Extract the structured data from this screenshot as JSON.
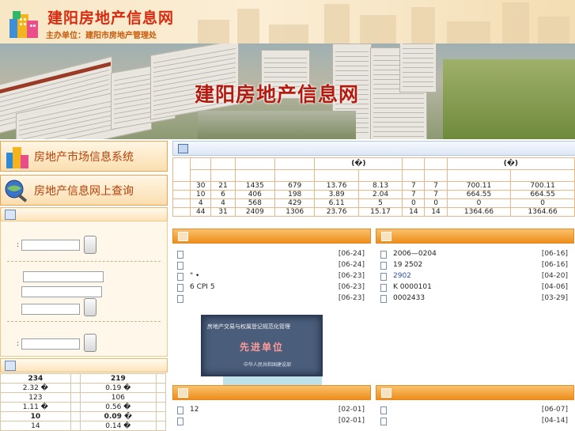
{
  "header": {
    "site_name": "建阳房地产信息网",
    "sponsor": "主办单位：建阳市房地产管理处"
  },
  "banner": {
    "title": "建阳房地产信息网"
  },
  "left": {
    "market_system_label": "房地产市场信息系统",
    "online_query_label": "房地产信息网上查询",
    "search_colon_1": ":",
    "search_colon_2": ":",
    "stats_rows": [
      {
        "a": "234",
        "b": "",
        "c": "219",
        "d": "",
        "bold": true
      },
      {
        "a": "2.32 �",
        "b": "",
        "c": "0.19 �",
        "d": ""
      },
      {
        "a": "123",
        "b": "",
        "c": "106",
        "d": ""
      },
      {
        "a": "1.11 �",
        "b": "",
        "c": "0.56 �",
        "d": ""
      },
      {
        "a": "10",
        "b": "",
        "c": "0.09 �",
        "d": "",
        "bold": true
      },
      {
        "a": "14",
        "b": "",
        "c": "0.14 �",
        "d": ""
      }
    ]
  },
  "right_stats": {
    "header_unit_1": "(�)",
    "header_unit_2": "(�)",
    "rows": [
      [
        "30",
        "21",
        "1435",
        "679",
        "13.76",
        "8.13",
        "7",
        "7",
        "700.11",
        "700.11"
      ],
      [
        "10",
        "6",
        "406",
        "198",
        "3.89",
        "2.04",
        "7",
        "7",
        "664.55",
        "664.55"
      ],
      [
        "4",
        "4",
        "568",
        "429",
        "6.11",
        "5",
        "0",
        "0",
        "0",
        "0"
      ],
      [
        "44",
        "31",
        "2409",
        "1306",
        "23.76",
        "15.17",
        "14",
        "14",
        "1364.66",
        "1364.66"
      ]
    ]
  },
  "news_left_top": [
    {
      "title": "",
      "date": "[06-24]"
    },
    {
      "title": "",
      "date": "[06-24]"
    },
    {
      "title": "\" •",
      "date": "[06-23]"
    },
    {
      "title": "6 CPI   5",
      "date": "[06-23]"
    },
    {
      "title": "",
      "date": "[06-23]"
    }
  ],
  "news_right_top": [
    {
      "title": "2006—0204",
      "date": "[06-16]"
    },
    {
      "title": "19 2502",
      "date": "[06-16]"
    },
    {
      "title": "2902",
      "date": "[04-20]"
    },
    {
      "title": "K  0000101",
      "date": "[04-06]"
    },
    {
      "title": "0002433",
      "date": "[03-29]"
    }
  ],
  "plaque": {
    "line1": "房地产交易与权属登记规范化管理",
    "line2": "先进单位",
    "line3": "中华人民共和国建设部"
  },
  "news_left_bottom": [
    {
      "title": "12",
      "date": "[02-01]"
    },
    {
      "title": "",
      "date": "[02-01]"
    }
  ],
  "news_right_bottom": [
    {
      "title": "",
      "date": "[06-07]"
    },
    {
      "title": "",
      "date": "[04-14]"
    }
  ]
}
